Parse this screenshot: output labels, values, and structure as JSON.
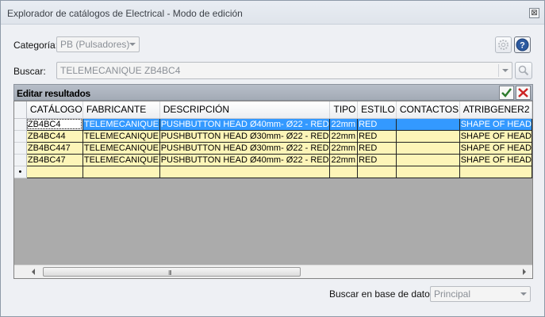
{
  "window": {
    "title": "Explorador de catálogos de Electrical - Modo de edición",
    "close_glyph": "⊠"
  },
  "form": {
    "category_label": "Categoría:",
    "category_value": "PB (Pulsadores)",
    "search_label": "Buscar:",
    "search_value": "TELEMECANIQUE ZB4BC4"
  },
  "icons": {
    "settings": "gear-icon",
    "help": "help-icon",
    "search": "search-icon",
    "accept": "check-icon",
    "cancel": "close-icon"
  },
  "results": {
    "title": "Editar resultados",
    "accept_glyph": "✔",
    "cancel_glyph": "✖",
    "columns": [
      "CATÁLOGO",
      "FABRICANTE",
      "DESCRIPCIÓN",
      "TIPO",
      "ESTILO",
      "CONTACTOS",
      "ATRIBGENER2"
    ],
    "rows": [
      [
        "ZB4BC4",
        "TELEMECANIQUE",
        "PUSHBUTTON HEAD Ø40mm- Ø22 - RED",
        "22mm",
        "RED",
        "",
        "SHAPE OF HEAD"
      ],
      [
        "ZB4BC44",
        "TELEMECANIQUE",
        "PUSHBUTTON HEAD Ø30mm- Ø22 - RED",
        "22mm",
        "RED",
        "",
        "SHAPE OF HEAD"
      ],
      [
        "ZB4BC447",
        "TELEMECANIQUE",
        "PUSHBUTTON HEAD Ø30mm- Ø22 - RED",
        "22mm",
        "RED",
        "",
        "SHAPE OF HEAD"
      ],
      [
        "ZB4BC47",
        "TELEMECANIQUE",
        "PUSHBUTTON HEAD Ø40mm- Ø22 - RED",
        "22mm",
        "RED",
        "",
        "SHAPE OF HEAD"
      ]
    ],
    "new_row_marker": "•",
    "scroll_grip": "III"
  },
  "footer": {
    "db_label": "Buscar en base de datos:",
    "db_value": "Principal"
  }
}
